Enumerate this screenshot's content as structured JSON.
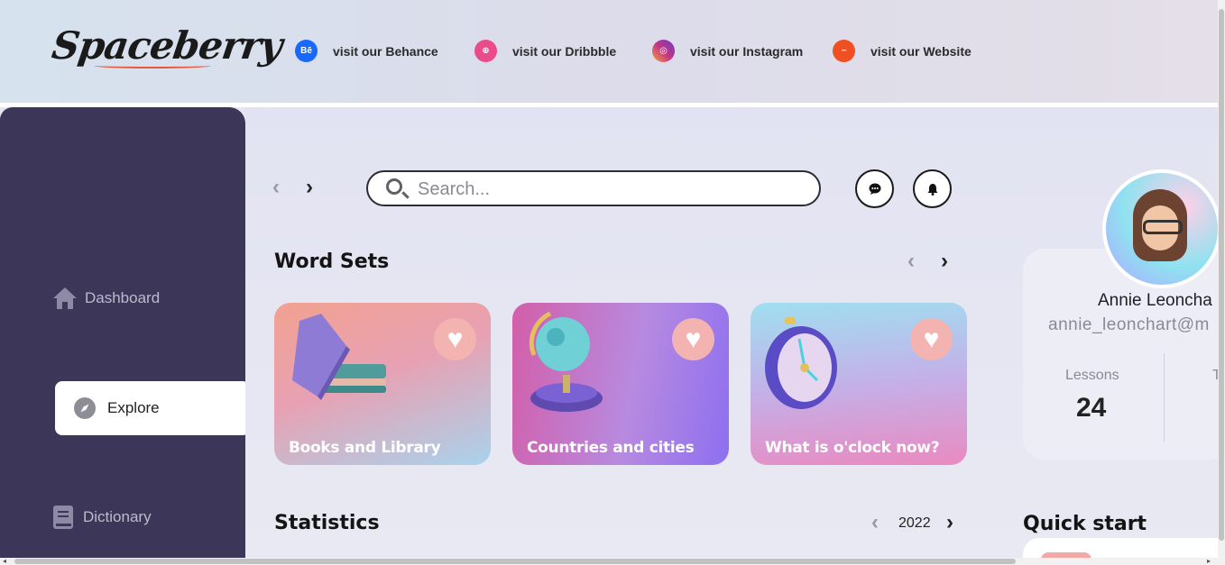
{
  "brand": {
    "logo_text": "Spaceberry"
  },
  "social_links": [
    {
      "icon": "behance-icon",
      "glyph": "Bē",
      "color": "#1769ff",
      "label": "visit our Behance"
    },
    {
      "icon": "dribbble-icon",
      "glyph": "⊕",
      "color": "#ea4c89",
      "label": "visit our Dribbble"
    },
    {
      "icon": "instagram-icon",
      "glyph": "◎",
      "color": "#c13584",
      "label": "visit our Instagram"
    },
    {
      "icon": "website-icon",
      "glyph": "~",
      "color": "#f04e23",
      "label": "visit our Website"
    }
  ],
  "sidebar": {
    "items": [
      {
        "icon": "home-icon",
        "label": "Dashboard",
        "active": false
      },
      {
        "icon": "compass-icon",
        "label": "Explore",
        "active": true
      },
      {
        "icon": "book-icon",
        "label": "Dictionary",
        "active": false
      }
    ]
  },
  "search": {
    "placeholder": "Search...",
    "value": ""
  },
  "header_buttons": {
    "chat_icon": "chat-icon",
    "bell_icon": "bell-icon"
  },
  "word_sets": {
    "title": "Word Sets",
    "cards": [
      {
        "title": "Books and Library",
        "favorite": true,
        "illustration": "books-illustration"
      },
      {
        "title": "Countries and cities",
        "favorite": true,
        "illustration": "globe-illustration"
      },
      {
        "title": "What is o'clock now?",
        "favorite": true,
        "illustration": "clock-illustration"
      }
    ]
  },
  "statistics": {
    "title": "Statistics",
    "year": "2022"
  },
  "profile": {
    "name": "Annie Leoncha",
    "email": "annie_leonchart@m",
    "stats": [
      {
        "label": "Lessons",
        "value": "24"
      },
      {
        "label": "T",
        "value": ""
      }
    ]
  },
  "quick_start": {
    "title": "Quick start"
  },
  "colors": {
    "sidebar": "#3c3658",
    "accent": "#f3b3b0",
    "background": "#e6e6f2"
  }
}
